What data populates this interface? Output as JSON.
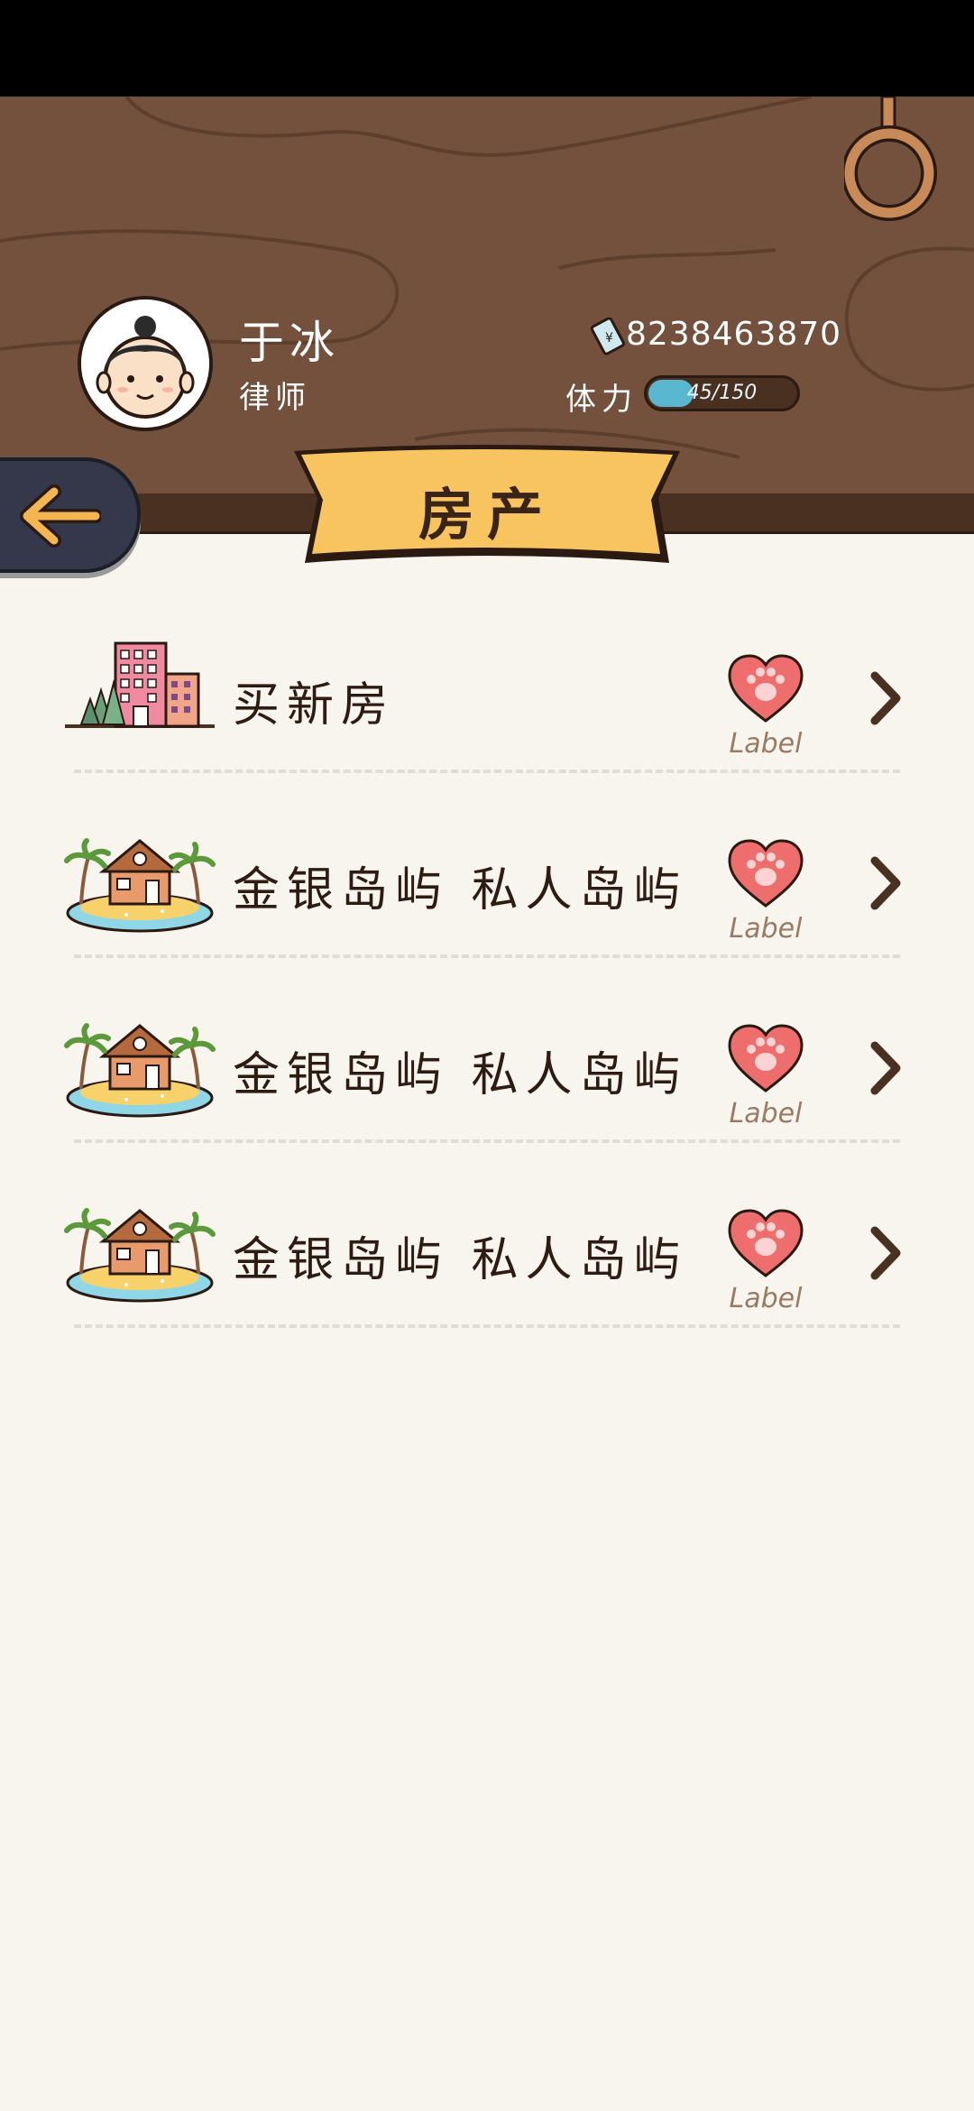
{
  "profile": {
    "name": "于冰",
    "occupation": "律师",
    "money": "8238463870",
    "stamina_label": "体力",
    "stamina_text": "45/150",
    "stamina_fraction": 0.3
  },
  "page": {
    "title": "房产"
  },
  "properties": [
    {
      "title": "买新房",
      "label": "Label",
      "icon": "city-buildings-icon"
    },
    {
      "title": "金银岛屿  私人岛屿",
      "label": "Label",
      "icon": "island-house-icon"
    },
    {
      "title": "金银岛屿  私人岛屿",
      "label": "Label",
      "icon": "island-house-icon"
    },
    {
      "title": "金银岛屿  私人岛屿",
      "label": "Label",
      "icon": "island-house-icon"
    }
  ],
  "colors": {
    "wood": "#73513d",
    "banner": "#f7c460",
    "heart": "#ee6e6e",
    "stamina": "#5ab7d0",
    "background": "#f8f4ee"
  }
}
